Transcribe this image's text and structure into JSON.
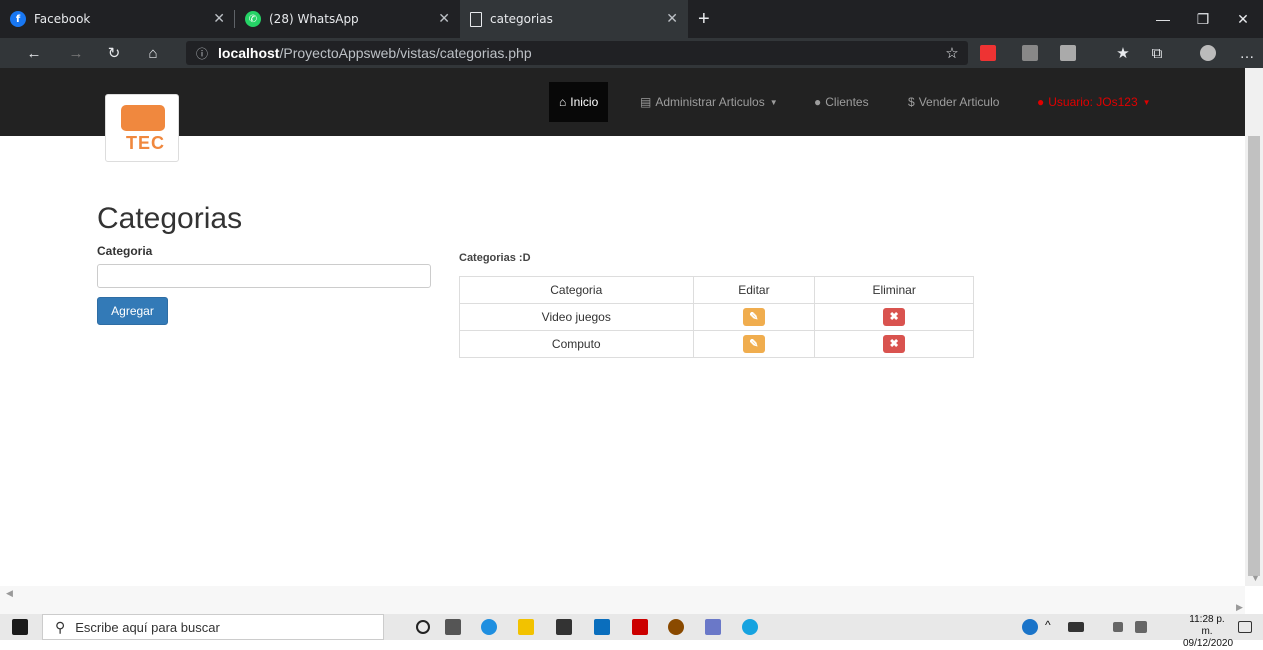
{
  "browser": {
    "tabs": [
      {
        "label": "Facebook",
        "icon": "facebook-icon"
      },
      {
        "label": "(28) WhatsApp",
        "icon": "whatsapp-icon",
        "badge": "28"
      },
      {
        "label": "categorias",
        "icon": "page-icon"
      }
    ],
    "url_host": "localhost",
    "url_path": "/ProyectoAppsweb/vistas/categorias.php"
  },
  "navbar": {
    "inicio": "Inicio",
    "administrar": "Administrar Articulos",
    "clientes": "Clientes",
    "vender": "Vender Articulo",
    "usuario": "Usuario: JOs123"
  },
  "logo": {
    "text": "TEC"
  },
  "page": {
    "title": "Categorias",
    "field_label": "Categoria",
    "add_button": "Agregar",
    "table_caption": "Categorias :D"
  },
  "table": {
    "headers": [
      "Categoria",
      "Editar",
      "Eliminar"
    ],
    "rows": [
      {
        "categoria": "Video juegos"
      },
      {
        "categoria": "Computo"
      }
    ]
  },
  "taskbar": {
    "search_placeholder": "Escribe aquí para buscar",
    "time": "11:28 p. m.",
    "date": "09/12/2020"
  },
  "colors": {
    "navbar_bg": "#222222",
    "primary": "#337ab7",
    "warning": "#f0ad4e",
    "danger": "#d9534f",
    "user_link": "#e00000"
  }
}
